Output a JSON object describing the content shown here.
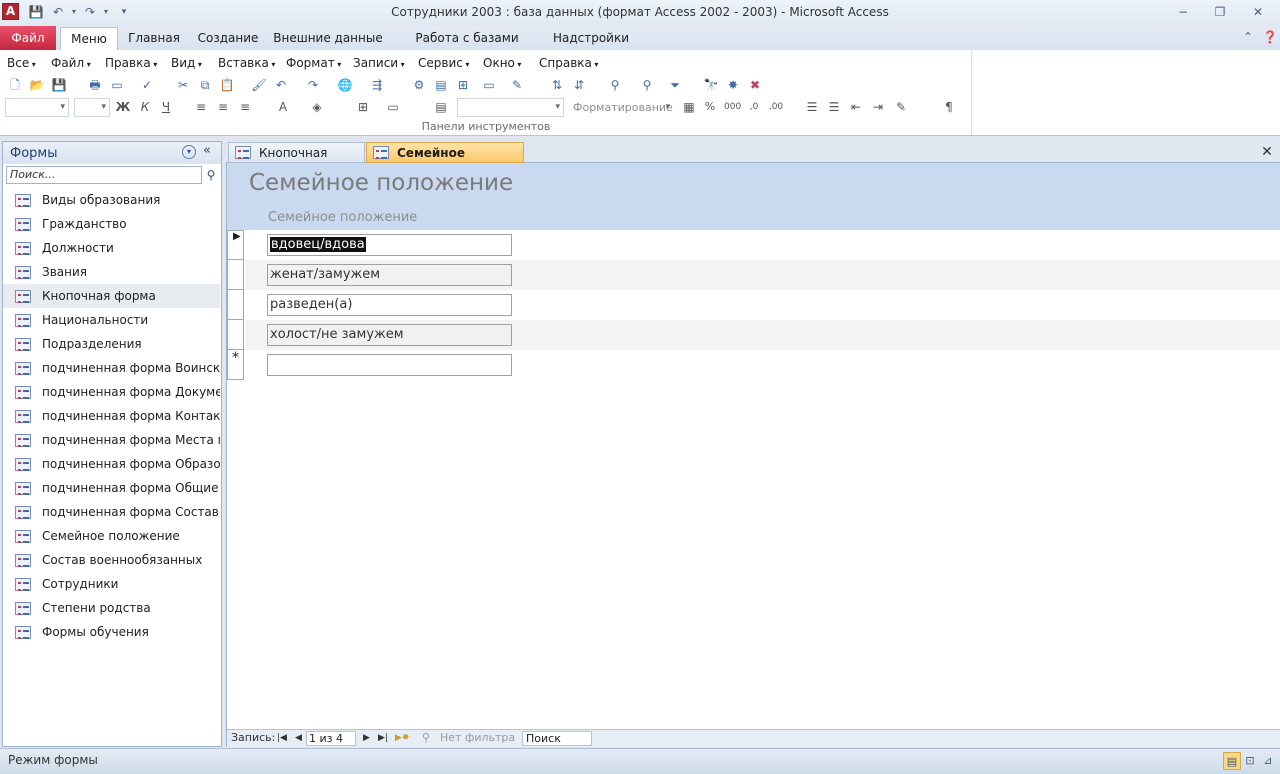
{
  "window": {
    "title": "Сотрудники 2003 : база данных (формат Access 2002 - 2003)  -  Microsoft Access",
    "app_logo": "A"
  },
  "ribbon": {
    "tabs": [
      "Файл",
      "Меню",
      "Главная",
      "Создание",
      "Внешние данные",
      "Работа с базами данных",
      "Надстройки"
    ],
    "menus": [
      "Все",
      "Файл",
      "Правка",
      "Вид",
      "Вставка",
      "Формат",
      "Записи",
      "Сервис",
      "Окно",
      "Справка"
    ],
    "format_combo": "Форматирование",
    "caption": "Панели инструментов"
  },
  "nav": {
    "title": "Формы",
    "search_placeholder": "Поиск...",
    "items": [
      "Виды образования",
      "Гражданство",
      "Должности",
      "Звания",
      "Кнопочная форма",
      "Национальности",
      "Подразделения",
      "подчиненная форма Воински...",
      "подчиненная форма Докумен...",
      "подчиненная форма Контакты",
      "подчиненная форма Места п...",
      "подчиненная форма Образов...",
      "подчиненная форма Общие с...",
      "подчиненная форма Состав с...",
      "Семейное положение",
      "Состав военнообязанных",
      "Сотрудники",
      "Степени родства",
      "Формы обучения"
    ]
  },
  "doc": {
    "tabs": [
      "Кнопочная форма",
      "Семейное положение"
    ],
    "form_title": "Семейное положение",
    "field_label": "Семейное положение",
    "records": [
      "вдовец/вдова",
      "женат/замужем",
      "разведен(а)",
      "холост/не замужем"
    ],
    "new_record_marker": "*",
    "current_marker": "▶"
  },
  "record_nav": {
    "label": "Запись:",
    "current": "1 из 4",
    "filter": "Нет фильтра",
    "search": "Поиск"
  },
  "status": {
    "text": "Режим формы"
  },
  "colors": {
    "file_tab": "#c4283f",
    "form_header": "#c9d9ef",
    "active_doctab": "#fbc96b"
  }
}
